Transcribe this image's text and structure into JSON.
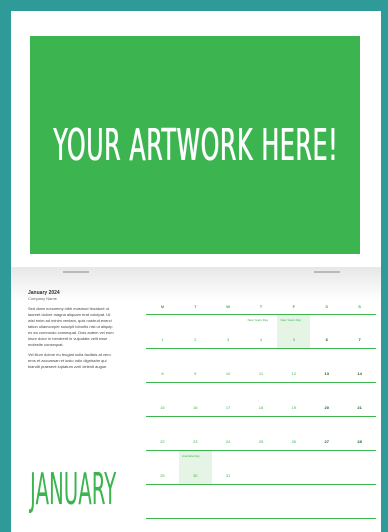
{
  "artwork": {
    "text": "YOUR ARTWORK HERE!"
  },
  "info": {
    "title": "January 2024",
    "subtitle": "Company Name",
    "paragraphs": [
      "Sed diam nonummy nibh euismod tincidunt ut laoreet dolore magna aliquam erat volutpat. Ut wisi enim ad minim veniam, quis nostrud exerci tation ullamcorper suscipit lobortis nisl ut aliquip ex ea commodo consequat. Duis autem vel eum iriure dolor in hendrerit in vulputate velit esse molestie consequat.",
      "Vel illum dolore eu feugiat nulla facilisis at vero eros et accumsan et iusto odio dignissim qui blandit praesent luptatum zzril delenit augue."
    ]
  },
  "month": "JANUARY",
  "calendar": {
    "weekdays": [
      "M",
      "T",
      "W",
      "T",
      "F",
      "S",
      "S"
    ],
    "weeks": [
      [
        {
          "n": "1"
        },
        {
          "n": "2"
        },
        {
          "n": "3"
        },
        {
          "n": "4",
          "ev": "New Years Day"
        },
        {
          "n": "5",
          "ev": "New Years Day",
          "hl": true
        },
        {
          "n": "6"
        },
        {
          "n": "7"
        }
      ],
      [
        {
          "n": "8"
        },
        {
          "n": "9"
        },
        {
          "n": "10"
        },
        {
          "n": "11"
        },
        {
          "n": "12"
        },
        {
          "n": "13"
        },
        {
          "n": "14"
        }
      ],
      [
        {
          "n": "15"
        },
        {
          "n": "16"
        },
        {
          "n": "17"
        },
        {
          "n": "18"
        },
        {
          "n": "19"
        },
        {
          "n": "20"
        },
        {
          "n": "21"
        }
      ],
      [
        {
          "n": "22"
        },
        {
          "n": "23"
        },
        {
          "n": "24"
        },
        {
          "n": "25"
        },
        {
          "n": "26"
        },
        {
          "n": "27"
        },
        {
          "n": "28"
        }
      ],
      [
        {
          "n": "29"
        },
        {
          "n": "30",
          "ev": "Australia Day",
          "hl": true
        },
        {
          "n": "31"
        },
        {
          "n": ""
        },
        {
          "n": ""
        },
        {
          "n": ""
        },
        {
          "n": ""
        }
      ],
      [
        {
          "n": ""
        },
        {
          "n": ""
        },
        {
          "n": ""
        },
        {
          "n": ""
        },
        {
          "n": ""
        },
        {
          "n": ""
        },
        {
          "n": ""
        }
      ]
    ]
  }
}
